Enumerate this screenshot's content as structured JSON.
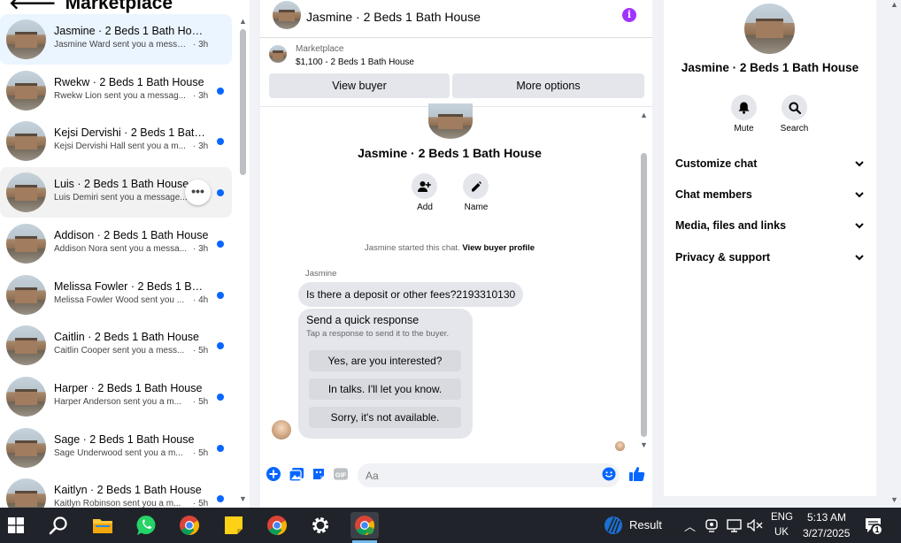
{
  "left_panel": {
    "title": "Marketplace",
    "conversations": [
      {
        "name": "Jasmine · 2 Beds 1 Bath House",
        "snippet": "Jasmine Ward sent you a message ...",
        "time": "· 3h",
        "unread": false,
        "active": true
      },
      {
        "name": "Rwekw · 2 Beds 1 Bath House",
        "snippet": "Rwekw Lion sent you a messag...",
        "time": "· 3h",
        "unread": true
      },
      {
        "name": "Kejsi Dervishi · 2 Beds 1 Bath ...",
        "snippet": "Kejsi Dervishi Hall sent you a m...",
        "time": "· 3h",
        "unread": true
      },
      {
        "name": "Luis · 2 Beds 1 Bath House",
        "snippet": "Luis Demiri sent you a message...",
        "time": "· 3h",
        "unread": true,
        "hovered": true
      },
      {
        "name": "Addison · 2 Beds 1 Bath House",
        "snippet": "Addison Nora sent you a messa...",
        "time": "· 3h",
        "unread": true
      },
      {
        "name": "Melissa Fowler · 2 Beds 1 Bath...",
        "snippet": "Melissa Fowler Wood sent you ...",
        "time": "· 4h",
        "unread": true
      },
      {
        "name": "Caitlin · 2 Beds 1 Bath House",
        "snippet": "Caitlin Cooper sent you a mess...",
        "time": "· 5h",
        "unread": true
      },
      {
        "name": "Harper · 2 Beds 1 Bath House",
        "snippet": "Harper Anderson sent you a m...",
        "time": "· 5h",
        "unread": true
      },
      {
        "name": "Sage · 2 Beds 1 Bath House",
        "snippet": "Sage Underwood sent you a m...",
        "time": "· 5h",
        "unread": true
      },
      {
        "name": "Kaitlyn · 2 Beds 1 Bath House",
        "snippet": "Kaitlyn Robinson sent you a m...",
        "time": "· 5h",
        "unread": true
      }
    ]
  },
  "chat": {
    "header_title": "Jasmine · 2 Beds 1 Bath House",
    "marketplace_label": "Marketplace",
    "listing": "$1,100 - 2 Beds 1 Bath House",
    "view_buyer": "View buyer",
    "more_options": "More options",
    "chat_title": "Jasmine · 2 Beds 1 Bath House",
    "add_label": "Add",
    "name_label": "Name",
    "system_text": "Jasmine started this chat.",
    "view_buyer_profile": "View buyer profile",
    "sender": "Jasmine",
    "message": "Is there a deposit or other fees?2193310130",
    "quick_title": "Send a quick response",
    "quick_subtitle": "Tap a response to send it to the buyer.",
    "quick_responses": [
      "Yes, are you interested?",
      "In talks. I'll let you know.",
      "Sorry, it's not available."
    ],
    "input_placeholder": "Aa"
  },
  "details": {
    "title": "Jasmine · 2 Beds 1 Bath House",
    "mute": "Mute",
    "search": "Search",
    "sections": [
      "Customize chat",
      "Chat members",
      "Media, files and links",
      "Privacy & support"
    ]
  },
  "taskbar": {
    "weather": "Result",
    "lang1": "ENG",
    "lang2": "UK",
    "time": "5:13 AM",
    "date": "3/27/2025",
    "notifications": "1"
  },
  "colors": {
    "accent": "#0866ff",
    "info": "#a033ff",
    "taskbar": "#20232a"
  }
}
